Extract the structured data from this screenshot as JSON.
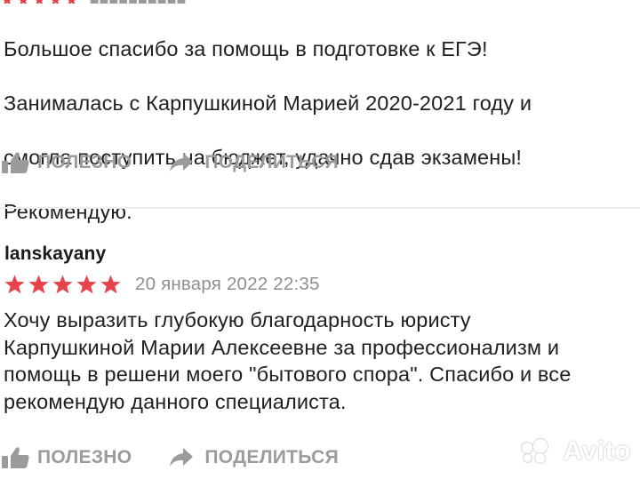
{
  "reviews": [
    {
      "text_lines": [
        "Большое спасибо за помощь в подготовке к ЕГЭ!",
        "Занималась с Карпушкиной Марией 2020-2021 году и",
        "смогла поступить на бюджет, удачно сдав экзамены!",
        "Рекомендую."
      ],
      "actions": {
        "useful": "ПОЛЕЗНО",
        "share": "ПОДЕЛИТЬСЯ"
      }
    },
    {
      "author": "lanskayany",
      "rating": 5,
      "date": "20 января 2022 22:35",
      "text_lines": [
        "Хочу выразить глубокую благодарность юристу",
        "Карпушкиной Марии Алексеевне за профессионализм и",
        "помощь в решени моего \"бытового спора\". Спасибо и все",
        "рекомендую данного специалиста."
      ],
      "actions": {
        "useful": "ПОЛЕЗНО",
        "share": "ПОДЕЛИТЬСЯ"
      }
    }
  ],
  "watermark": {
    "text": "Avito",
    "icon": "avito-logo-icon"
  },
  "colors": {
    "star": "#e8434a",
    "action": "#9b9b9b",
    "date": "#8f8f8f",
    "divider": "#eeeeee"
  }
}
